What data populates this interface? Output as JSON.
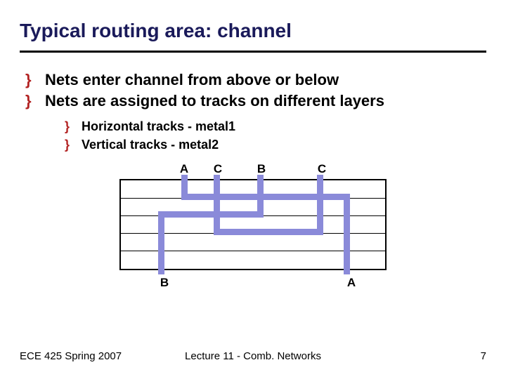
{
  "title": "Typical routing area: channel",
  "bullets": {
    "b1": "Nets enter channel from above or below",
    "b2": "Nets are assigned to tracks on different layers",
    "s1": "Horizontal tracks - metal1",
    "s2": "Vertical tracks - metal2"
  },
  "labels": {
    "topA": "A",
    "topC1": "C",
    "topB": "B",
    "topC2": "C",
    "botB": "B",
    "botA": "A"
  },
  "footer": {
    "left": "ECE 425 Spring 2007",
    "center": "Lecture 11 - Comb. Networks",
    "right": "7"
  }
}
